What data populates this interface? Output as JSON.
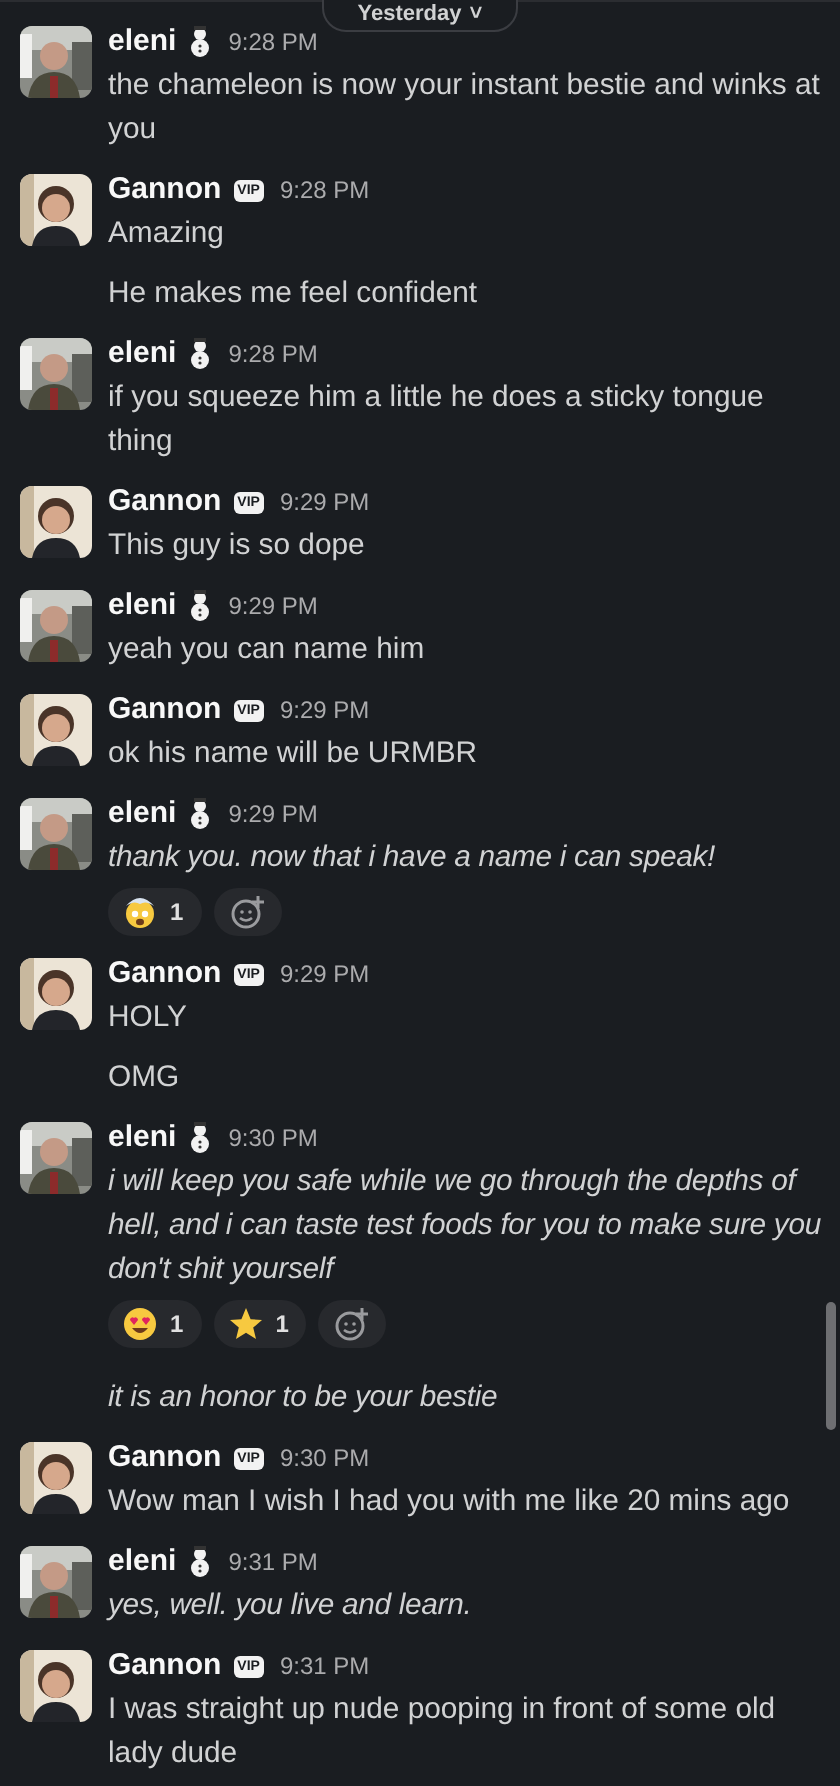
{
  "date_divider": {
    "label": "Yesterday",
    "caret": "˅"
  },
  "groups": [
    {
      "author": "eleni",
      "badge": {
        "kind": "snowman"
      },
      "time": "9:28 PM",
      "messages": [
        {
          "text": "the chameleon is now your instant bestie and winks at you",
          "italic": false
        }
      ]
    },
    {
      "author": "Gannon",
      "badge": {
        "kind": "vip",
        "text": "VIP"
      },
      "time": "9:28 PM",
      "messages": [
        {
          "text": "Amazing",
          "italic": false
        },
        {
          "text": "He makes me feel confident",
          "italic": false
        }
      ]
    },
    {
      "author": "eleni",
      "badge": {
        "kind": "snowman"
      },
      "time": "9:28 PM",
      "messages": [
        {
          "text": "if you squeeze him a little he does a sticky tongue thing",
          "italic": false
        }
      ]
    },
    {
      "author": "Gannon",
      "badge": {
        "kind": "vip",
        "text": "VIP"
      },
      "time": "9:29 PM",
      "messages": [
        {
          "text": "This guy is so dope",
          "italic": false
        }
      ]
    },
    {
      "author": "eleni",
      "badge": {
        "kind": "snowman"
      },
      "time": "9:29 PM",
      "messages": [
        {
          "text": "yeah you can name him",
          "italic": false
        }
      ]
    },
    {
      "author": "Gannon",
      "badge": {
        "kind": "vip",
        "text": "VIP"
      },
      "time": "9:29 PM",
      "messages": [
        {
          "text": "ok his name will be URMBR",
          "italic": false
        }
      ]
    },
    {
      "author": "eleni",
      "badge": {
        "kind": "snowman"
      },
      "time": "9:29 PM",
      "messages": [
        {
          "text": "thank you. now that i have a name i can speak!",
          "italic": true,
          "reactions": [
            {
              "kind": "mind-blown",
              "count": "1"
            }
          ]
        }
      ]
    },
    {
      "author": "Gannon",
      "badge": {
        "kind": "vip",
        "text": "VIP"
      },
      "time": "9:29 PM",
      "messages": [
        {
          "text": "HOLY",
          "italic": false
        },
        {
          "text": "OMG",
          "italic": false
        }
      ]
    },
    {
      "author": "eleni",
      "badge": {
        "kind": "snowman"
      },
      "time": "9:30 PM",
      "messages": [
        {
          "text": "i will keep you safe while we go through the depths of hell, and i can taste test foods for you to make sure you don't shit yourself",
          "italic": true,
          "reactions": [
            {
              "kind": "heart-eyes",
              "count": "1"
            },
            {
              "kind": "star",
              "count": "1"
            }
          ]
        },
        {
          "text": "it is an honor to be your bestie",
          "italic": true
        }
      ]
    },
    {
      "author": "Gannon",
      "badge": {
        "kind": "vip",
        "text": "VIP"
      },
      "time": "9:30 PM",
      "messages": [
        {
          "text": "Wow man I wish I had you with me like 20 mins ago",
          "italic": false
        }
      ]
    },
    {
      "author": "eleni",
      "badge": {
        "kind": "snowman"
      },
      "time": "9:31 PM",
      "messages": [
        {
          "text": "yes, well. you live and learn.",
          "italic": true
        }
      ]
    },
    {
      "author": "Gannon",
      "badge": {
        "kind": "vip",
        "text": "VIP"
      },
      "time": "9:31 PM",
      "messages": [
        {
          "text": "I was straight up nude pooping in front of some old lady dude",
          "italic": false
        }
      ]
    }
  ]
}
